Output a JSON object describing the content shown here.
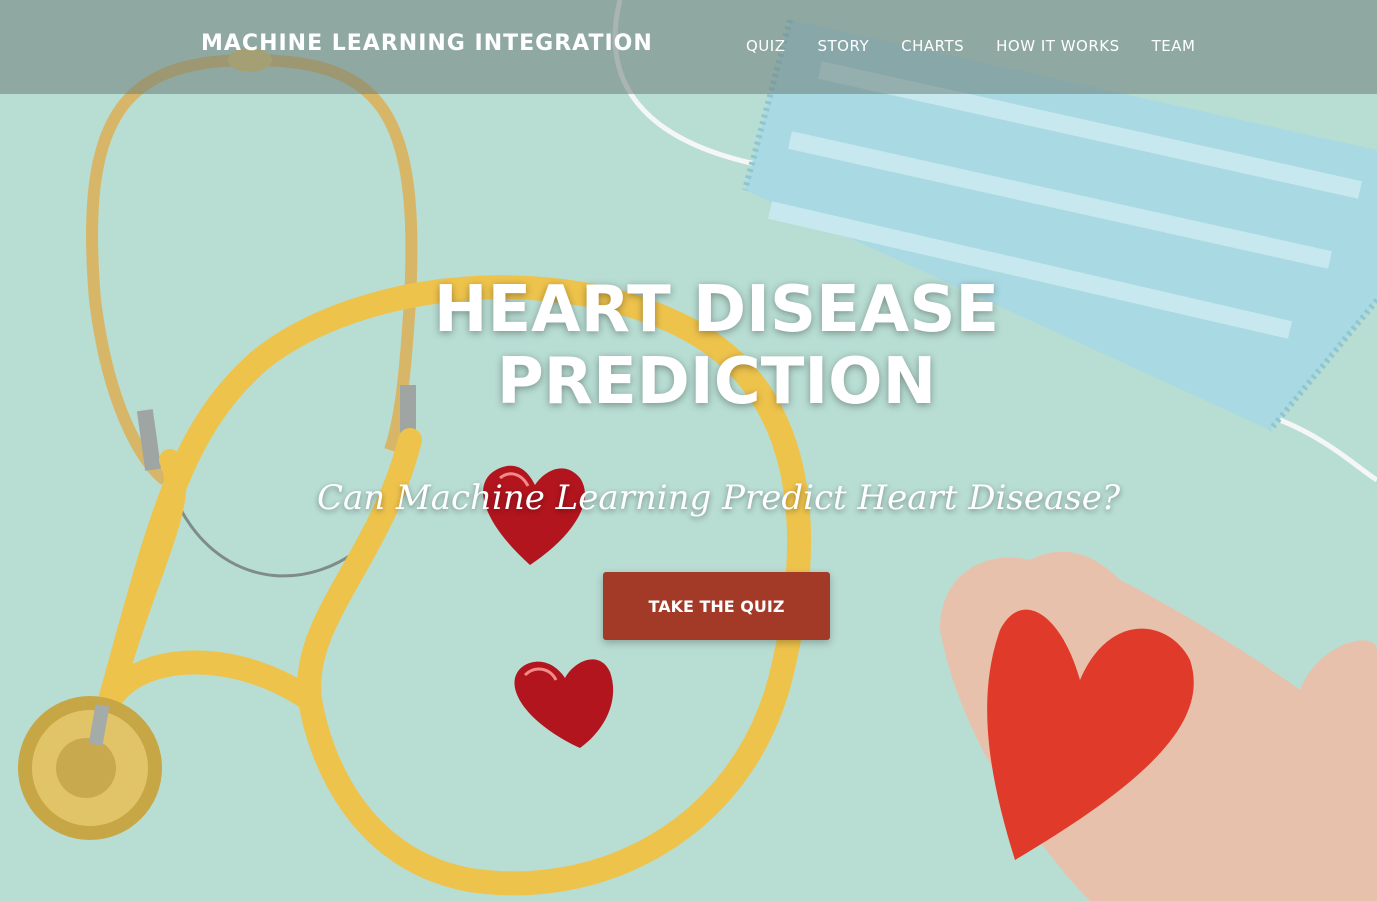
{
  "brand": {
    "title": "MACHINE LEARNING INTEGRATION"
  },
  "nav": {
    "items": [
      {
        "label": "QUIZ"
      },
      {
        "label": "STORY"
      },
      {
        "label": "CHARTS"
      },
      {
        "label": "HOW IT WORKS"
      },
      {
        "label": "TEAM"
      }
    ]
  },
  "hero": {
    "headline_line1": "HEART DISEASE",
    "headline_line2": "PREDICTION",
    "subheadline": "Can Machine Learning Predict Heart Disease?",
    "cta_label": "TAKE THE QUIZ"
  },
  "colors": {
    "background": "#b8ddd3",
    "cta": "#a33a28",
    "stethoscope": "#eec34c",
    "heart": "#e03a2a",
    "mask": "#9fd3de"
  },
  "image": {
    "objects": [
      "stethoscope",
      "surgical-mask",
      "chocolate-heart",
      "chocolate-heart",
      "hand-holding-paper-heart"
    ]
  }
}
